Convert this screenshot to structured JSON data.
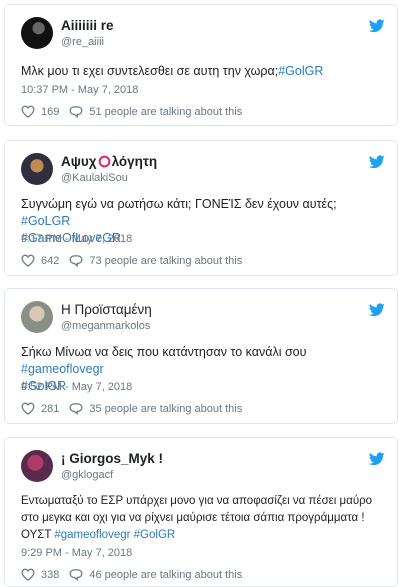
{
  "tweets": [
    {
      "name": "Aiiiiiii re",
      "handle": "@re_aiiii",
      "text": "Μλκ μου τι εχει συντελεσθει σε αυτη την χωρα;",
      "hashtags": [
        "#GolGR"
      ],
      "time": "10:37 PM - May 7, 2018",
      "likes": "169",
      "talking": "51 people are talking about this"
    },
    {
      "name_pre": "Αψυχ",
      "name_post": "λόγητη",
      "handle": "@KaulakiSou",
      "text": "Συγνώμη εγώ να ρωτήσω κάτι; ΓΟΝΕΊΣ δεν έχουν αυτές;",
      "hashtags": [
        "#GoLGR",
        "#GameOfLoveGR"
      ],
      "time": "9:17 PM - May 7, 2018",
      "likes": "642",
      "talking": "73 people are talking about this"
    },
    {
      "name": "Η Προϊσταμένη",
      "handle": "@meganmarkolos",
      "text": "Σήκω Μίνωα να δεις που κατάντησαν το κανάλι σου",
      "hashtags": [
        "#gameoflovegr",
        "#GolGR"
      ],
      "time": "9:52 PM - May 7, 2018",
      "likes": "281",
      "talking": "35 people are talking about this"
    },
    {
      "name": "¡ Giorgos_Myk !",
      "handle": "@gklogacf",
      "text_line1": "Εντωματαξύ το ΕΣΡ υπάρχει μονο για να αποφασίζει να πέσει μαύρο",
      "text_line2": "στο μεγκα και οχι για να ρίχνει μαύρισε τέτοια σάπια προγράμματα !",
      "text_line3": "ΟΥΣΤ",
      "hashtags": [
        "#gameoflovegr",
        "#GolGR"
      ],
      "time": "9:29 PM - May 7, 2018",
      "likes": "338",
      "talking": "46 people are talking about this"
    }
  ],
  "colors": {
    "link": "#2b7bb9",
    "bird": "#1da1f2",
    "meta": "#697882",
    "o_mark": "#e0245e"
  },
  "icons": [
    "twitter-bird-icon",
    "heart-icon",
    "reply-bubble-icon"
  ]
}
